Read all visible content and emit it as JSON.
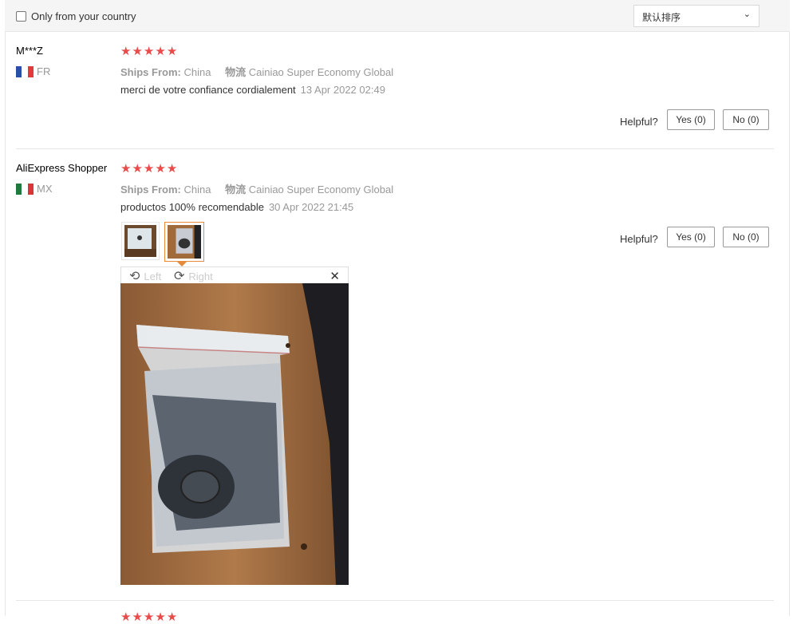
{
  "filter": {
    "only_country_label": "Only from your country",
    "checked": false
  },
  "sort": {
    "selected": "默认排序"
  },
  "labels": {
    "ships_from": "Ships From:",
    "logistics": "物流",
    "helpful": "Helpful?",
    "rotate_left": "Left",
    "rotate_right": "Right"
  },
  "reviews": [
    {
      "name": "M***Z",
      "country": "FR",
      "rating": 5,
      "ships_from": "China",
      "logistics": "Cainiao Super Economy Global",
      "text": "merci de votre confiance cordialement",
      "date": "13 Apr 2022 02:49",
      "yes": "Yes (0)",
      "no": "No (0)"
    },
    {
      "name": "AliExpress Shopper",
      "country": "MX",
      "rating": 5,
      "ships_from": "China",
      "logistics": "Cainiao Super Economy Global",
      "text": "productos 100% recomendable",
      "date": "30 Apr 2022 21:45",
      "yes": "Yes (0)",
      "no": "No (0)"
    }
  ],
  "icons": {
    "star": "★",
    "rotate_left": "⟲",
    "rotate_right": "⟳",
    "close": "✕",
    "chevron": "⌄"
  },
  "colors": {
    "star": "#e94b4b",
    "active_thumb": "#e68a3b"
  }
}
